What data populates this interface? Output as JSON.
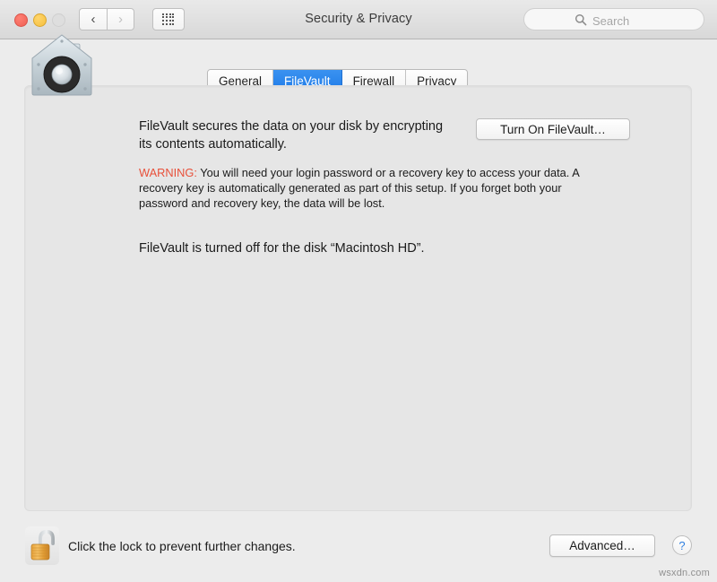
{
  "window": {
    "title": "Security & Privacy",
    "traffic_lights": [
      {
        "name": "close",
        "color": "#ef6054"
      },
      {
        "name": "minimize",
        "color": "#f5bf3f"
      },
      {
        "name": "zoom",
        "color": "#dedede"
      }
    ],
    "nav": {
      "back_icon": "‹",
      "forward_icon": "›",
      "grid_icon": "show-all-grid"
    }
  },
  "search": {
    "placeholder": "Search",
    "value": "",
    "icon": "search-icon"
  },
  "tabs": [
    {
      "label": "General",
      "selected": false
    },
    {
      "label": "FileVault",
      "selected": true
    },
    {
      "label": "Firewall",
      "selected": false
    },
    {
      "label": "Privacy",
      "selected": false
    }
  ],
  "filevault": {
    "icon": "filevault-safe-icon",
    "headline": "FileVault secures the data on your disk by encrypting its contents automatically.",
    "warning_label": "WARNING:",
    "warning_text": " You will need your login password or a recovery key to access your data. A recovery key is automatically generated as part of this setup. If you forget both your password and recovery key, the data will be lost.",
    "status": "FileVault is turned off for the disk “Macintosh HD”.",
    "turn_on_button": "Turn On FileVault…"
  },
  "footer": {
    "lock_icon": "unlocked-padlock-icon",
    "lock_text": "Click the lock to prevent further changes.",
    "advanced_button": "Advanced…",
    "help_button": "?"
  },
  "watermark": "wsxdn.com",
  "colors": {
    "accent_blue": "#1f7be8",
    "warning_red": "#e8503a",
    "window_bg": "#ececec",
    "panel_bg": "#e6e6e6"
  }
}
